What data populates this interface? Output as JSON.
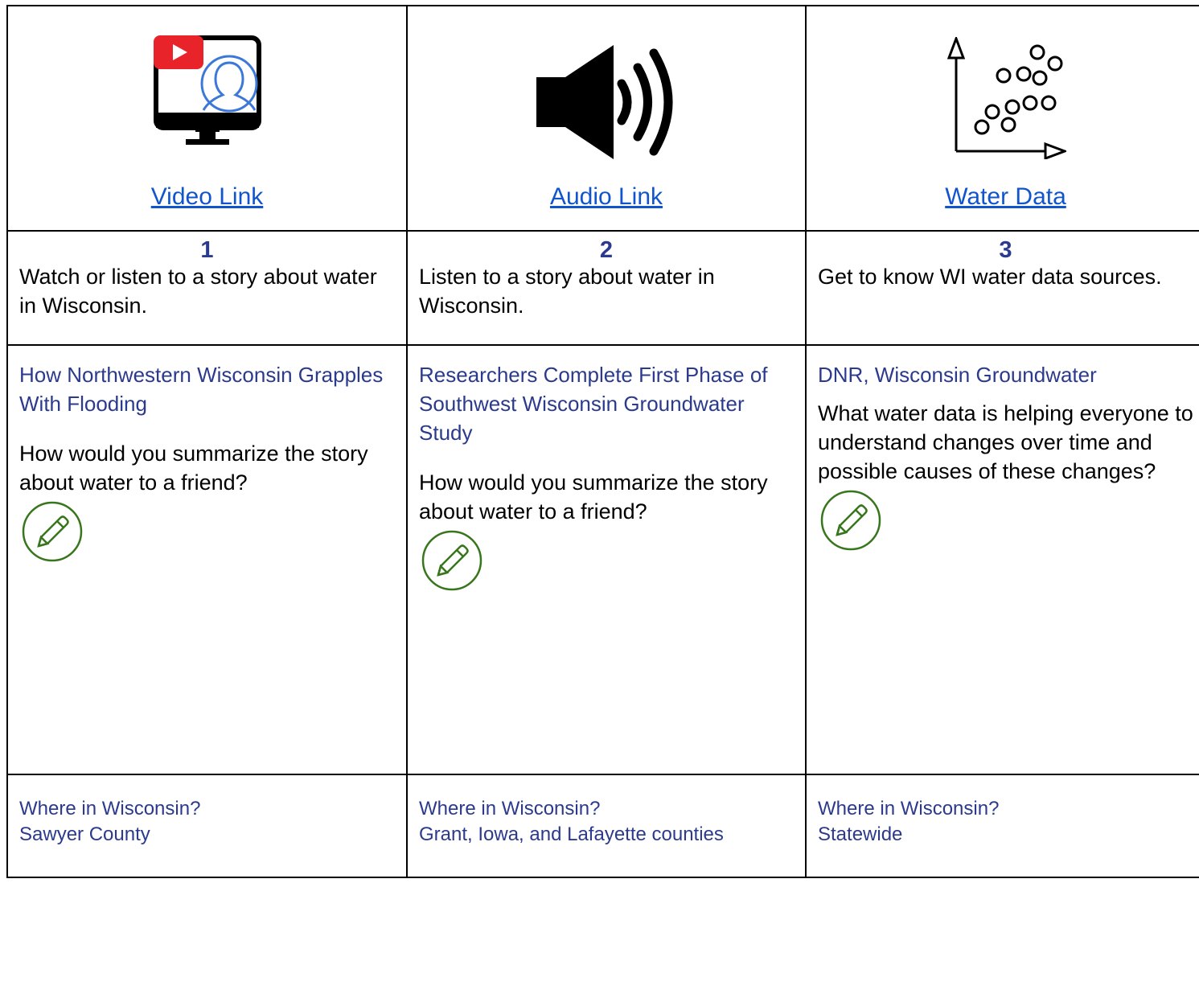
{
  "columns": [
    {
      "icon": "video-monitor-icon",
      "media_link": "Video Link",
      "step_number": "1",
      "step_text": "Watch or listen to a story about water in Wisconsin.",
      "story_title": "How Northwestern Wisconsin Grapples With Flooding",
      "question": "How would you summarize the story about water to a friend?",
      "where_label": "Where in Wisconsin?",
      "where_value": "Sawyer County"
    },
    {
      "icon": "speaker-icon",
      "media_link": "Audio Link",
      "step_number": "2",
      "step_text": "Listen to a story about water in Wisconsin.",
      "story_title": "Researchers Complete First Phase of Southwest Wisconsin Groundwater Study",
      "question": "How would you summarize the story about water to a friend?",
      "where_label": "Where in Wisconsin?",
      "where_value": "Grant, Iowa, and Lafayette counties"
    },
    {
      "icon": "scatter-plot-icon",
      "media_link": "Water Data",
      "step_number": "3",
      "step_text": "Get to know WI water data sources.",
      "story_title": "DNR, Wisconsin Groundwater",
      "question": "What water data is helping everyone to understand changes over time and possible causes of these changes?",
      "where_label": "Where in Wisconsin?",
      "where_value": "Statewide"
    }
  ],
  "colors": {
    "link": "#1155cc",
    "accent": "#2b3a8c",
    "pencil": "#38761d",
    "youtube_red": "#e8232a",
    "monitor_blue": "#3c78d8"
  }
}
